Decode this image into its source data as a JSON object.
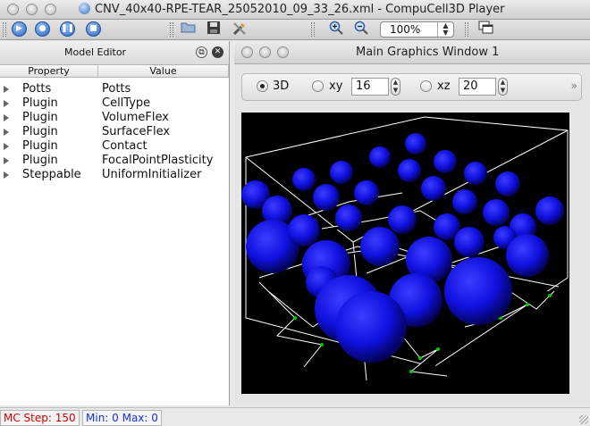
{
  "window": {
    "title": "CNV_40x40-RPE-TEAR_25052010_09_33_26.xml - CompuCell3D Player"
  },
  "toolbar": {
    "run_icon": "play-icon",
    "step_icon": "step-icon",
    "pause_icon": "pause-icon",
    "stop_icon": "stop-icon",
    "zoom": "100%"
  },
  "model_editor": {
    "title": "Model Editor",
    "columns": [
      "Property",
      "Value"
    ],
    "rows": [
      {
        "property": "Potts",
        "value": "Potts"
      },
      {
        "property": "Plugin",
        "value": "CellType"
      },
      {
        "property": "Plugin",
        "value": "VolumeFlex"
      },
      {
        "property": "Plugin",
        "value": "SurfaceFlex"
      },
      {
        "property": "Plugin",
        "value": "Contact"
      },
      {
        "property": "Plugin",
        "value": "FocalPointPlasticity"
      },
      {
        "property": "Steppable",
        "value": "UniformInitializer"
      }
    ]
  },
  "graphics": {
    "title": "Main Graphics Window 1",
    "modes": [
      {
        "label": "3D",
        "selected": true
      },
      {
        "label": "xy",
        "selected": false,
        "value": "16"
      },
      {
        "label": "xz",
        "selected": false,
        "value": "20"
      }
    ],
    "more": "»"
  },
  "status": {
    "mc_step": "MC Step: 150",
    "minmax": "Min: 0 Max: 0"
  },
  "colors": {
    "mc_step": "#d40000",
    "minmax": "#1a2fd6",
    "cells": "#1e1eff"
  }
}
